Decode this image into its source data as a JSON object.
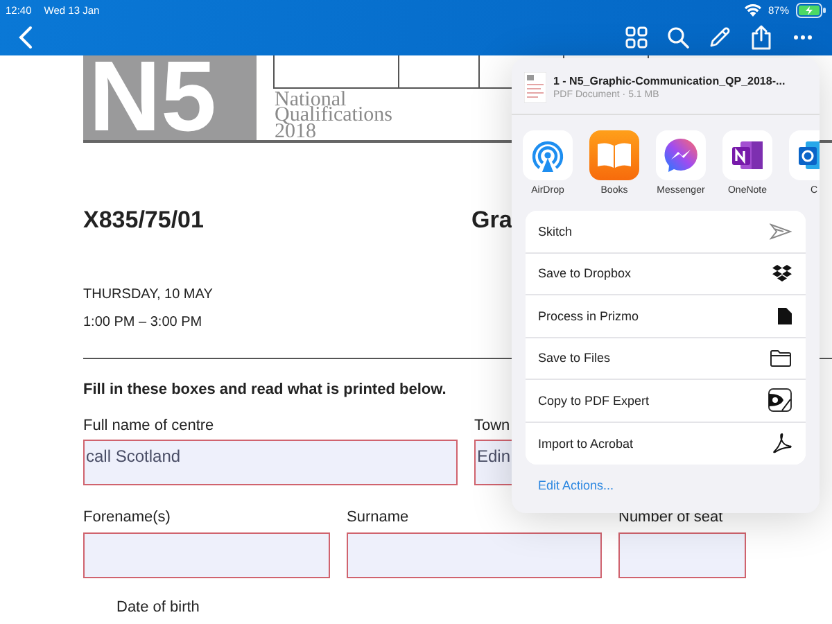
{
  "status_bar": {
    "time": "12:40",
    "date": "Wed 13 Jan",
    "battery": "87%"
  },
  "toolbar": {
    "buttons": [
      {
        "kind": "back"
      },
      {
        "kind": "grid"
      },
      {
        "kind": "search"
      },
      {
        "kind": "pencil"
      },
      {
        "kind": "share"
      },
      {
        "kind": "more"
      }
    ]
  },
  "document": {
    "logo": "N5",
    "qualification": [
      "National",
      "Qualifications",
      "2018"
    ],
    "code": "X835/75/01",
    "subject": "Gra",
    "date": "THURSDAY, 10 MAY",
    "time": "1:00 PM – 3:00 PM",
    "instruction": "Fill in these boxes and read what is printed below.",
    "field_rows": [
      [
        {
          "label": "Full name of centre",
          "value": "call Scotland"
        },
        {
          "label": "Town",
          "value": "Edin"
        }
      ],
      [
        {
          "label": "Forename(s)"
        },
        {
          "label": "Surname"
        },
        {
          "label": "Number of seat"
        }
      ]
    ],
    "date_of_birth": "Date of birth"
  },
  "share_sheet": {
    "file": {
      "name": "1 - N5_Graphic-Communication_QP_2018-...",
      "info": "PDF Document · 5.1 MB"
    },
    "apps": [
      {
        "name": "AirDrop",
        "kind": "airdrop"
      },
      {
        "name": "Books",
        "kind": "books"
      },
      {
        "name": "Messenger",
        "kind": "messenger"
      },
      {
        "name": "OneNote",
        "kind": "onenote"
      },
      {
        "name": "C",
        "kind": "outlook"
      }
    ],
    "actions": [
      {
        "label": "Skitch",
        "kind": "skitch"
      },
      {
        "label": "Save to Dropbox",
        "kind": "dropbox"
      },
      {
        "label": "Process in Prizmo",
        "kind": "prizmo"
      },
      {
        "label": "Save to Files",
        "kind": "files"
      },
      {
        "label": "Copy to PDF Expert",
        "kind": "pdfexpert"
      },
      {
        "label": "Import to Acrobat",
        "kind": "acrobat"
      }
    ],
    "edit_link": "Edit Actions..."
  }
}
